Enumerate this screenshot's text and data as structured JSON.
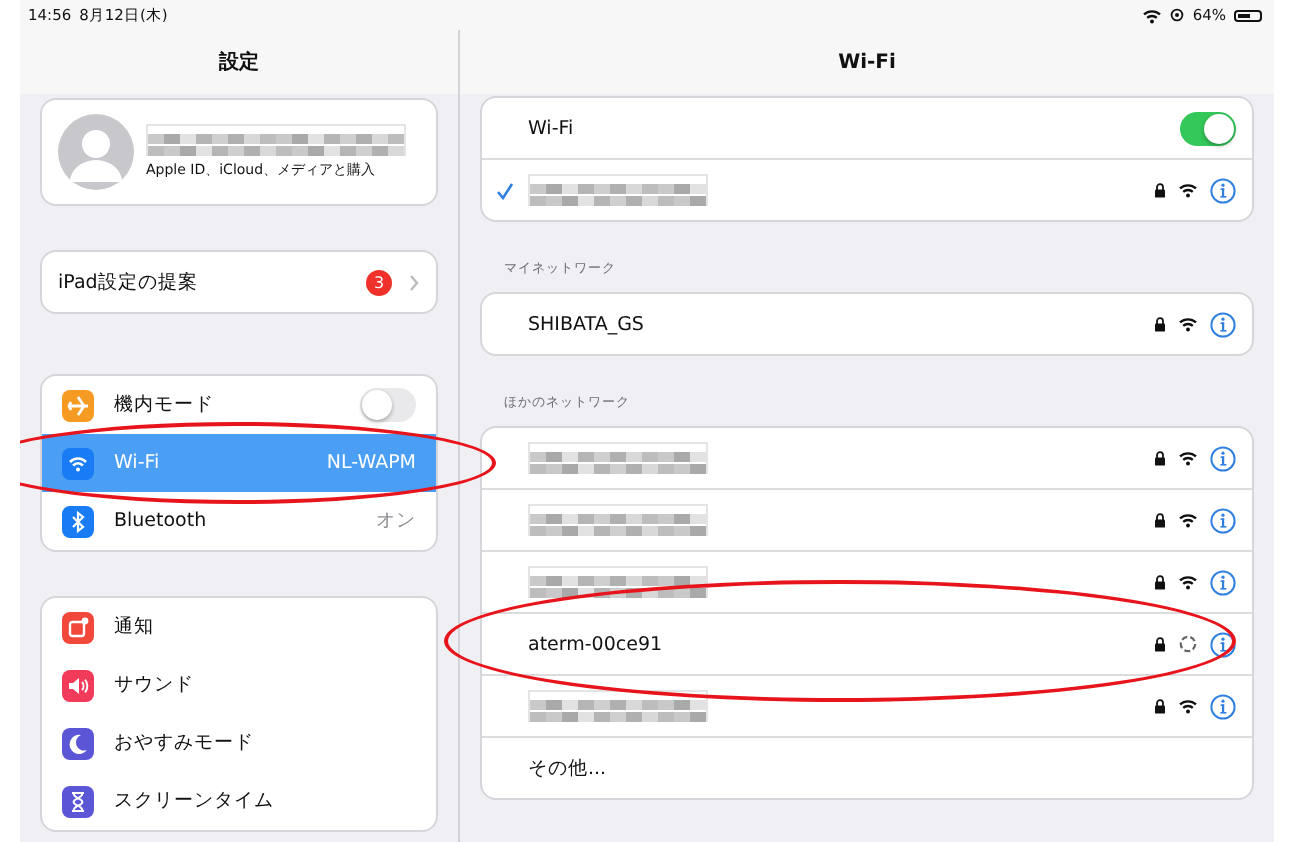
{
  "status_bar": {
    "time": "14:56",
    "date": "8月12日(木)",
    "battery": "64%"
  },
  "sidebar": {
    "title": "設定",
    "profile": {
      "name_redacted": true,
      "subtitle": "Apple ID、iCloud、メディアと購入"
    },
    "suggestion": {
      "label": "iPad設定の提案",
      "badge": "3"
    },
    "groups": [
      {
        "items": [
          {
            "label": "機内モード",
            "kind": "toggle",
            "on": false,
            "selected": false,
            "circled": false,
            "color": "#f59a23"
          },
          {
            "label": "Wi-Fi",
            "kind": "value",
            "value": "NL-WAPM",
            "selected": true,
            "circled": true,
            "color": "#1a7cf5"
          },
          {
            "label": "Bluetooth",
            "kind": "value",
            "value": "オン",
            "selected": false,
            "circled": false,
            "color": "#1a7cf5"
          }
        ]
      },
      {
        "items": [
          {
            "label": "通知",
            "kind": "link",
            "selected": false,
            "circled": false,
            "color": "#f2473b"
          },
          {
            "label": "サウンド",
            "kind": "link",
            "selected": false,
            "circled": false,
            "color": "#f23a5a"
          },
          {
            "label": "おやすみモード",
            "kind": "link",
            "selected": false,
            "circled": false,
            "color": "#5a56d6"
          },
          {
            "label": "スクリーンタイム",
            "kind": "link",
            "selected": false,
            "circled": false,
            "color": "#5a56d6"
          }
        ]
      }
    ]
  },
  "wifi": {
    "title": "Wi-Fi",
    "toggle": {
      "label": "Wi-Fi",
      "on": true
    },
    "current": {
      "redacted": true,
      "checked": true
    },
    "sections": [
      {
        "header": "マイネットワーク",
        "networks": [
          {
            "name": "SHIBATA_GS",
            "redacted": false,
            "connecting": false,
            "circled": false
          }
        ]
      },
      {
        "header": "ほかのネットワーク",
        "networks": [
          {
            "redacted": true,
            "connecting": false,
            "circled": false
          },
          {
            "redacted": true,
            "connecting": false,
            "circled": false
          },
          {
            "redacted": true,
            "connecting": false,
            "circled": false
          },
          {
            "name": "aterm-00ce91",
            "redacted": false,
            "connecting": true,
            "circled": true
          },
          {
            "redacted": true,
            "connecting": false,
            "circled": false
          }
        ],
        "other": "その他..."
      }
    ]
  }
}
